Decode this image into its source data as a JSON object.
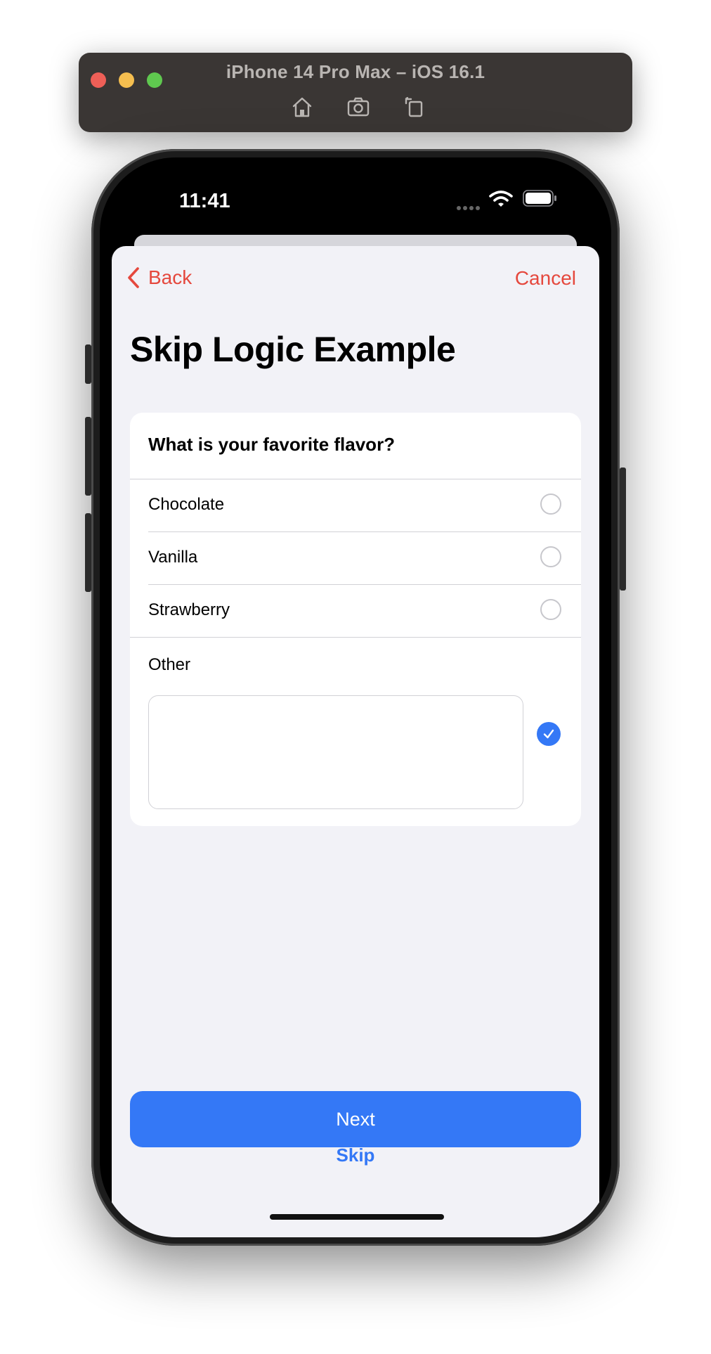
{
  "simulator": {
    "title": "iPhone 14 Pro Max – iOS 16.1",
    "tools": [
      "home-icon",
      "screenshot-icon",
      "rotate-icon"
    ]
  },
  "statusbar": {
    "time": "11:41"
  },
  "nav": {
    "back_label": "Back",
    "cancel_label": "Cancel"
  },
  "page": {
    "title": "Skip Logic Example"
  },
  "question": {
    "text": "What is your favorite flavor?",
    "options": [
      {
        "label": "Chocolate",
        "selected": false
      },
      {
        "label": "Vanilla",
        "selected": false
      },
      {
        "label": "Strawberry",
        "selected": false
      }
    ],
    "other": {
      "label": "Other",
      "value": "",
      "selected": true
    }
  },
  "footer": {
    "next_label": "Next",
    "skip_label": "Skip"
  },
  "colors": {
    "accent_red": "#e5483d",
    "accent_blue": "#3478f6",
    "background": "#f2f2f7"
  }
}
